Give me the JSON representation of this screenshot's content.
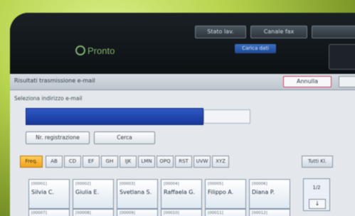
{
  "topbar": {
    "buttons": [
      "Stato lav.",
      "Canale fax",
      ""
    ],
    "brand": "Pronto",
    "status_chip": "Carica dati"
  },
  "panel": {
    "title": "Risultati trasmissione e-mail",
    "cancel_label": "Annulla",
    "subtitle": "Seleziona indirizzo e-mail",
    "buttons": {
      "registration": "Nr. registrazione",
      "search": "Cerca"
    },
    "tabs": [
      "Freq.",
      "AB",
      "CD",
      "EF",
      "GH",
      "IJK",
      "LMN",
      "OPQ",
      "RST",
      "UVW",
      "XYZ",
      "Tutti Kl."
    ],
    "entries": [
      {
        "num": "[00001]",
        "name": "Silvia C."
      },
      {
        "num": "[00002]",
        "name": "Giulia E."
      },
      {
        "num": "[00003]",
        "name": "Svetlana S."
      },
      {
        "num": "[00004]",
        "name": "Raffaela G."
      },
      {
        "num": "[00005]",
        "name": "Filippo A."
      },
      {
        "num": "[00006]",
        "name": "Diana P."
      }
    ],
    "entries_row2": [
      "[00007]",
      "[00008]",
      "[00009]",
      "[00010]",
      "[00011]",
      "[00012]"
    ],
    "pager": {
      "page": "1/2",
      "arrow": "↓"
    }
  },
  "colors": {
    "accent": "#2f58c4",
    "tab_active": "#f0a21b",
    "cancel_border": "#d8416b",
    "brand": "#7fb06a"
  }
}
